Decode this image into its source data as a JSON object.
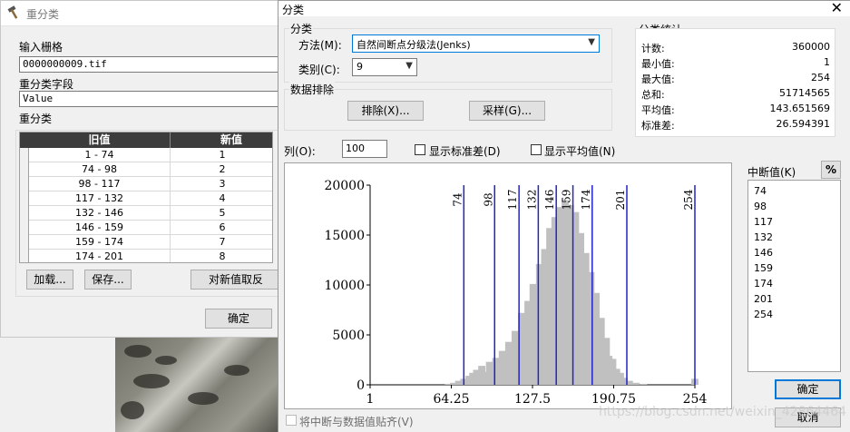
{
  "reclassify": {
    "title": "重分类",
    "input_raster_label": "输入栅格",
    "input_raster_value": "0000000009.tif",
    "field_label": "重分类字段",
    "field_value": "Value",
    "table_label": "重分类",
    "col_old": "旧值",
    "col_new": "新值",
    "rows": [
      {
        "old": "1 - 74",
        "new": "1"
      },
      {
        "old": "74 - 98",
        "new": "2"
      },
      {
        "old": "98 - 117",
        "new": "3"
      },
      {
        "old": "117 - 132",
        "new": "4"
      },
      {
        "old": "132 - 146",
        "new": "5"
      },
      {
        "old": "146 - 159",
        "new": "6"
      },
      {
        "old": "159 - 174",
        "new": "7"
      },
      {
        "old": "174 - 201",
        "new": "8"
      }
    ],
    "load_btn": "加载...",
    "save_btn": "保存...",
    "reverse_btn": "对新值取反",
    "ok_btn": "确定"
  },
  "classify": {
    "title": "分类",
    "close": "✕",
    "group_title": "分类",
    "method_label": "方法(M):",
    "method_value": "自然间断点分级法(Jenks)",
    "classes_label": "类别(C):",
    "classes_value": "9",
    "exclusion_title": "数据排除",
    "exclusion_btn": "排除(X)...",
    "sampling_btn": "采样(G)...",
    "stats_title": "分类统计",
    "stats": [
      {
        "k": "计数:",
        "v": "360000"
      },
      {
        "k": "最小值:",
        "v": "1"
      },
      {
        "k": "最大值:",
        "v": "254"
      },
      {
        "k": "总和:",
        "v": "51714565"
      },
      {
        "k": "平均值:",
        "v": "143.651569"
      },
      {
        "k": "标准差:",
        "v": "26.594391"
      }
    ],
    "columns_label": "列(O):",
    "columns_value": "100",
    "show_std_label": "显示标准差(D)",
    "show_mean_label": "显示平均值(N)",
    "breaks_label": "中断值(K)",
    "percent_btn": "%",
    "breaks": [
      "74",
      "98",
      "117",
      "132",
      "146",
      "159",
      "174",
      "201",
      "254"
    ],
    "snap_label": "将中断与数据值贴齐(V)",
    "ok_btn": "确定",
    "cancel_btn": "取消"
  },
  "watermark": "https://blog.csdn.net/weixin_42864464",
  "chart_data": {
    "type": "bar",
    "title": "",
    "xlabel": "",
    "ylabel": "",
    "xlim": [
      1,
      254
    ],
    "ylim": [
      0,
      20000
    ],
    "x_ticks": [
      "1",
      "64.25",
      "127.5",
      "190.75",
      "254"
    ],
    "y_ticks": [
      "0",
      "5000",
      "10000",
      "15000",
      "20000"
    ],
    "breaks": [
      74,
      98,
      117,
      132,
      146,
      159,
      174,
      201,
      254
    ],
    "break_color": "#2323c8",
    "bar_color": "#c0c0c0",
    "bins": [
      {
        "x": 62,
        "y": 100
      },
      {
        "x": 66,
        "y": 200
      },
      {
        "x": 70,
        "y": 400
      },
      {
        "x": 74,
        "y": 600
      },
      {
        "x": 78,
        "y": 900
      },
      {
        "x": 81,
        "y": 1200
      },
      {
        "x": 84,
        "y": 1500
      },
      {
        "x": 86,
        "y": 800
      },
      {
        "x": 88,
        "y": 1900
      },
      {
        "x": 91,
        "y": 1300
      },
      {
        "x": 94,
        "y": 2300
      },
      {
        "x": 96,
        "y": 1100
      },
      {
        "x": 99,
        "y": 2700
      },
      {
        "x": 101,
        "y": 1600
      },
      {
        "x": 104,
        "y": 3400
      },
      {
        "x": 106,
        "y": 2100
      },
      {
        "x": 109,
        "y": 4300
      },
      {
        "x": 111,
        "y": 2800
      },
      {
        "x": 114,
        "y": 5400
      },
      {
        "x": 116,
        "y": 3200
      },
      {
        "x": 119,
        "y": 7200
      },
      {
        "x": 121,
        "y": 4200
      },
      {
        "x": 124,
        "y": 8400
      },
      {
        "x": 126,
        "y": 5200
      },
      {
        "x": 128,
        "y": 10100
      },
      {
        "x": 130,
        "y": 6400
      },
      {
        "x": 133,
        "y": 12100
      },
      {
        "x": 135,
        "y": 8100
      },
      {
        "x": 137,
        "y": 13600
      },
      {
        "x": 139,
        "y": 9600
      },
      {
        "x": 141,
        "y": 15700
      },
      {
        "x": 143,
        "y": 11200
      },
      {
        "x": 145,
        "y": 16800
      },
      {
        "x": 147,
        "y": 12300
      },
      {
        "x": 149,
        "y": 17800
      },
      {
        "x": 151,
        "y": 14200
      },
      {
        "x": 153,
        "y": 18500
      },
      {
        "x": 155,
        "y": 15300
      },
      {
        "x": 157,
        "y": 18000
      },
      {
        "x": 159,
        "y": 14100
      },
      {
        "x": 161,
        "y": 17300
      },
      {
        "x": 163,
        "y": 12100
      },
      {
        "x": 165,
        "y": 15200
      },
      {
        "x": 167,
        "y": 10300
      },
      {
        "x": 169,
        "y": 13200
      },
      {
        "x": 171,
        "y": 8400
      },
      {
        "x": 173,
        "y": 11300
      },
      {
        "x": 175,
        "y": 7300
      },
      {
        "x": 177,
        "y": 9200
      },
      {
        "x": 179,
        "y": 5400
      },
      {
        "x": 181,
        "y": 6700
      },
      {
        "x": 183,
        "y": 4100
      },
      {
        "x": 185,
        "y": 4700
      },
      {
        "x": 187,
        "y": 2900
      },
      {
        "x": 190,
        "y": 2600
      },
      {
        "x": 193,
        "y": 1600
      },
      {
        "x": 196,
        "y": 1200
      },
      {
        "x": 199,
        "y": 700
      },
      {
        "x": 203,
        "y": 400
      },
      {
        "x": 208,
        "y": 200
      },
      {
        "x": 214,
        "y": 100
      },
      {
        "x": 254,
        "y": 600
      }
    ]
  }
}
